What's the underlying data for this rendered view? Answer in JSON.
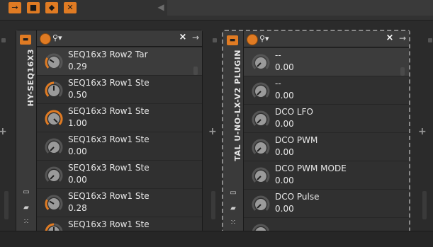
{
  "topbar": {
    "buttons": [
      "→",
      "■",
      "◆",
      "✕"
    ]
  },
  "devices": [
    {
      "title": "HY-SEQ16X3",
      "search_placeholder": "",
      "close_glyph": "×",
      "arrow_glyph": "→",
      "params": [
        {
          "name": "SEQ16x3 Row2 Tar",
          "value": "0.29",
          "level": 0.29,
          "accent": true
        },
        {
          "name": "SEQ16x3 Row1 Ste",
          "value": "0.50",
          "level": 0.5,
          "accent": true
        },
        {
          "name": "SEQ16x3 Row1 Ste",
          "value": "1.00",
          "level": 1.0,
          "accent": true
        },
        {
          "name": "SEQ16x3 Row1 Ste",
          "value": "0.00",
          "level": 0.0,
          "accent": false
        },
        {
          "name": "SEQ16x3 Row1 Ste",
          "value": "0.00",
          "level": 0.0,
          "accent": false
        },
        {
          "name": "SEQ16x3 Row1 Ste",
          "value": "0.28",
          "level": 0.28,
          "accent": true
        },
        {
          "name": "SEQ16x3 Row1 Ste",
          "value": "",
          "level": 0.5,
          "accent": true
        }
      ]
    },
    {
      "title": "TAL U-NO-LX-V2 PLUGIN",
      "search_placeholder": "",
      "close_glyph": "×",
      "arrow_glyph": "→",
      "params": [
        {
          "name": "--",
          "value": "0.00",
          "level": 0.0,
          "accent": false
        },
        {
          "name": "--",
          "value": "0.00",
          "level": 0.0,
          "accent": false
        },
        {
          "name": "DCO LFO",
          "value": "0.00",
          "level": 0.0,
          "accent": false
        },
        {
          "name": "DCO PWM",
          "value": "0.00",
          "level": 0.0,
          "accent": false
        },
        {
          "name": "DCO PWM MODE",
          "value": "0.00",
          "level": 0.0,
          "accent": false
        },
        {
          "name": "DCO Pulse",
          "value": "0.00",
          "level": 0.0,
          "accent": false
        },
        {
          "name": "",
          "value": "",
          "level": 0.0,
          "accent": true
        }
      ]
    }
  ],
  "colors": {
    "accent": "#e07b23",
    "knob_body": "#9a9a9a",
    "knob_track": "#555555"
  }
}
